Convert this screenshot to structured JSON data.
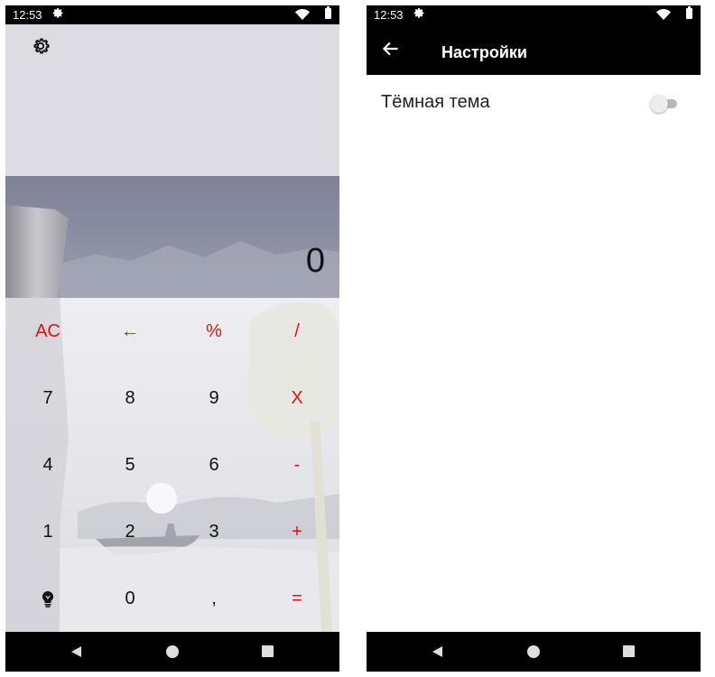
{
  "calculator": {
    "status": {
      "time": "12:53"
    },
    "display": {
      "value": "0"
    },
    "keys": {
      "ac": "AC",
      "backspace": "←",
      "percent": "%",
      "divide": "/",
      "seven": "7",
      "eight": "8",
      "nine": "9",
      "multiply": "X",
      "four": "4",
      "five": "5",
      "six": "6",
      "minus": "-",
      "one": "1",
      "two": "2",
      "three": "3",
      "plus": "+",
      "zero": "0",
      "comma": ",",
      "equals": "="
    },
    "icons": {
      "settings": "gear-icon",
      "theme_toggle": "lightbulb-icon"
    },
    "colors": {
      "operator": "#e01010",
      "digit": "#111111"
    }
  },
  "settings": {
    "status": {
      "time": "12:53"
    },
    "toolbar": {
      "title": "Настройки",
      "back_icon": "arrow-back-icon"
    },
    "preferences": [
      {
        "label": "Тёмная тема",
        "enabled": false
      }
    ]
  },
  "system_nav": {
    "icons": [
      "back-triangle-icon",
      "home-circle-icon",
      "recents-square-icon"
    ]
  }
}
